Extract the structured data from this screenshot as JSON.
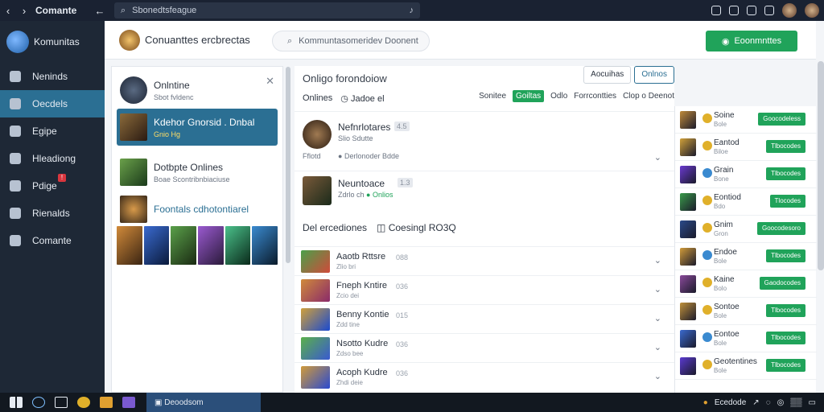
{
  "topbar": {
    "title": "Comante",
    "search_placeholder": "Sbonedtsfeague"
  },
  "sidebar": {
    "brand": "Komunitas",
    "items": [
      {
        "label": "Neninds",
        "icon": "home-icon"
      },
      {
        "label": "Oecdels",
        "icon": "chart-icon",
        "active": true
      },
      {
        "label": "Egipe",
        "icon": "folder-icon"
      },
      {
        "label": "Hleadiong",
        "icon": "key-icon"
      },
      {
        "label": "Pdige",
        "icon": "page-icon",
        "badge": "!"
      },
      {
        "label": "Rienalds",
        "icon": "list-icon"
      },
      {
        "label": "Comante",
        "icon": "globe-icon"
      }
    ]
  },
  "header": {
    "title": "Conuanttes ercbrectas",
    "search": "Kommuntasomeridev Doonent",
    "new_button": "Eoonmnttes"
  },
  "chats": [
    {
      "name": "Onlntine",
      "sub": "Sbot fvldenc"
    },
    {
      "name": "Kdehor Gnorsid . Dnbal",
      "sub": "Gnio Hg"
    },
    {
      "name": "Dotbpte Onlines",
      "sub": "Boae  Scontribnbiaciuse"
    },
    {
      "name": "Foontals cdhotontiarel",
      "sub": ""
    }
  ],
  "content": {
    "title": "Onligo forondoiow",
    "filter_label": "Onlines",
    "filter_sub": "Jadoe el",
    "btn1": "Aocuihas",
    "btn2": "Onlnos",
    "tabs": [
      "Sonitee",
      "Goiltas",
      "Odlo",
      "Forrcontties",
      "Clop o Deenot"
    ],
    "posts": [
      {
        "name": "Nefnrlotares",
        "tag": "4.5",
        "meta": "Slio Sdutte",
        "reply": "Derlonoder Bdde",
        "red": "Fflotd"
      },
      {
        "name": "Neuntoace",
        "tag": "1.3",
        "meta": "Zdrlo ch",
        "status": "Onlios"
      }
    ],
    "section": "Del ercediones",
    "section2": "Coesingl RO3Q",
    "items": [
      {
        "name": "Aaotb Rttsre",
        "count": "088",
        "sub": "Zlio bri"
      },
      {
        "name": "Fneph Kntire",
        "count": "036",
        "sub": "Zcio dei"
      },
      {
        "name": "Benny Kontie",
        "count": "015",
        "sub": "Zdd tine"
      },
      {
        "name": "Nsotto Kudre",
        "count": "036",
        "sub": "Zdso bee"
      },
      {
        "name": "Acoph Kudre",
        "count": "036",
        "sub": "Zhdi deie"
      }
    ]
  },
  "members": [
    {
      "name": "Soine",
      "sub": "Bole",
      "btn": "Goocodeless"
    },
    {
      "name": "Eantod",
      "sub": "Biloe",
      "btn": "Tlbocodes"
    },
    {
      "name": "Grain",
      "sub": "Bone",
      "btn": "Tlbocodes"
    },
    {
      "name": "Eontiod",
      "sub": "Bdo",
      "btn": "Tlocodes"
    },
    {
      "name": "Gnim",
      "sub": "Gron",
      "btn": "Goocodesoro"
    },
    {
      "name": "Endoe",
      "sub": "Bole",
      "btn": "Tlbocodes"
    },
    {
      "name": "Kaine",
      "sub": "Bolo",
      "btn": "Gaodocodes"
    },
    {
      "name": "Sontoe",
      "sub": "Bole",
      "btn": "Tlbocodes"
    },
    {
      "name": "Eontoe",
      "sub": "Bole",
      "btn": "Tlbocodes"
    },
    {
      "name": "Geotentines",
      "sub": "Bole",
      "btn": "Tlbocodes"
    }
  ],
  "taskbar": {
    "app": "Deoodsom",
    "tray": "Ecedode"
  },
  "colors": {
    "accent": "#2b6f93",
    "green": "#20a35a",
    "sidebar": "#1e2836"
  }
}
